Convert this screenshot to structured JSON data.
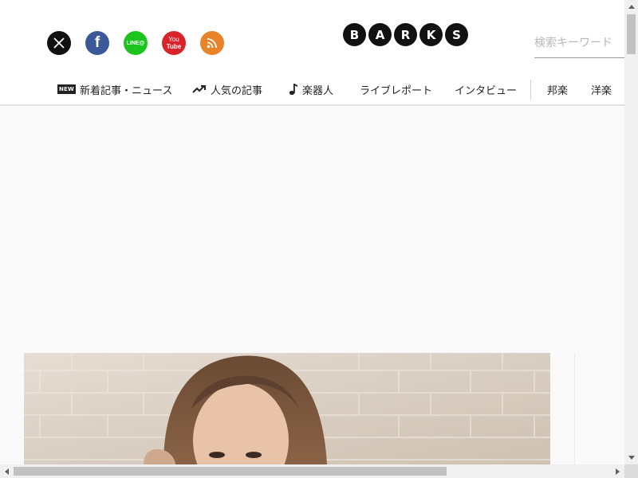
{
  "social": [
    {
      "name": "x",
      "label": "X",
      "color": "#111111"
    },
    {
      "name": "facebook",
      "label": "f",
      "color": "#3b5998"
    },
    {
      "name": "line",
      "label": "LINE@",
      "color": "#1dc41d"
    },
    {
      "name": "youtube",
      "label_top": "You",
      "label_bottom": "Tube",
      "color": "#d8232a"
    },
    {
      "name": "rss",
      "color": "#e8832a"
    }
  ],
  "logo": {
    "letters": [
      "B",
      "A",
      "R",
      "K",
      "S"
    ]
  },
  "search": {
    "placeholder": "検索キーワード"
  },
  "nav": {
    "items": [
      {
        "label": "新着記事・ニュース",
        "icon": "new-icon",
        "icon_text": "NEW"
      },
      {
        "label": "人気の記事",
        "icon": "trending-icon"
      },
      {
        "label": "楽器人",
        "icon": "music-note-icon"
      },
      {
        "label": "ライブレポート"
      },
      {
        "label": "インタビュー"
      },
      {
        "label": "邦楽"
      },
      {
        "label": "洋楽"
      }
    ]
  },
  "colors": {
    "accent": "#111111",
    "nav_text": "#222222",
    "divider": "#e2e2e2"
  }
}
